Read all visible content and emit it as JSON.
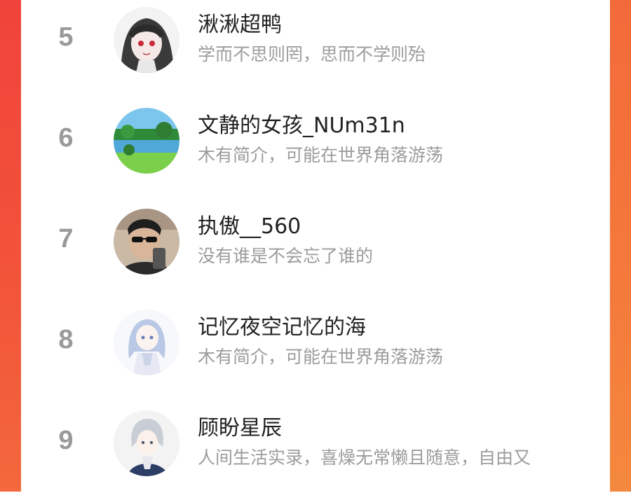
{
  "rankings": [
    {
      "rank": "5",
      "name": "湫湫超鸭",
      "bio": "学而不思则罔，思而不学则殆",
      "avatar": "anime-girl-dark-hair-avatar"
    },
    {
      "rank": "6",
      "name": "文静的女孩_NUm31n",
      "bio": "木有简介，可能在世界角落游荡",
      "avatar": "landscape-lake-avatar"
    },
    {
      "rank": "7",
      "name": "执傲__560",
      "bio": "没有谁是不会忘了谁的",
      "avatar": "man-sunglasses-selfie-avatar"
    },
    {
      "rank": "8",
      "name": "记忆夜空记忆的海",
      "bio": "木有简介，可能在世界角落游荡",
      "avatar": "anime-girl-blue-hair-avatar"
    },
    {
      "rank": "9",
      "name": "顾盼星辰",
      "bio": "人间生活实录，喜燥无常懒且随意，自由又",
      "avatar": "anime-boy-silver-hair-avatar"
    }
  ],
  "colors": {
    "accent_left": "#f0433b",
    "accent_right": "#f47a3b",
    "rank": "#9a9a9a",
    "name": "#222222",
    "bio": "#9c9c9c"
  }
}
